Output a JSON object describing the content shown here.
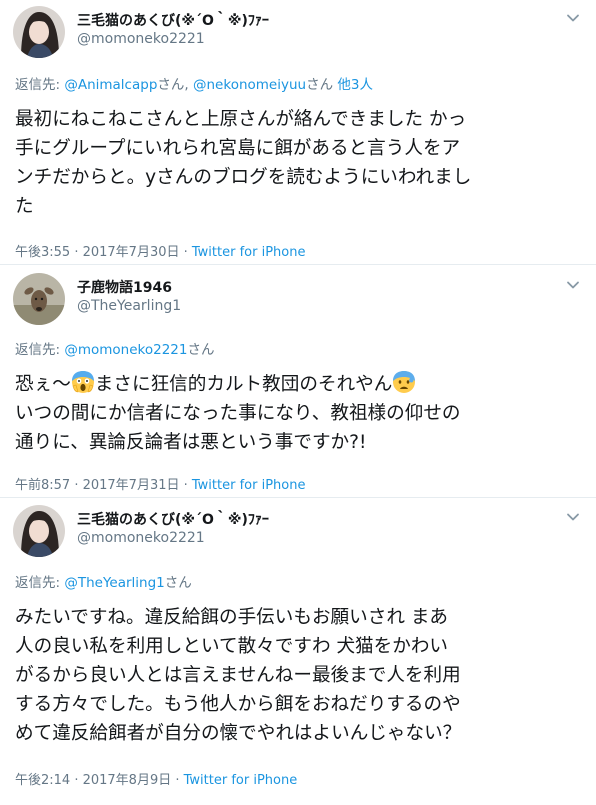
{
  "tweets": [
    {
      "display_name": "三毛猫のあくび(※´O｀※)ﾌｧｰ",
      "handle": "@momoneko2221",
      "reply_prefix": "返信先: ",
      "reply_link1": "@Animalcapp",
      "reply_san1": "さん, ",
      "reply_link2": "@nekonomeiyuu",
      "reply_san2": "さん ",
      "reply_more": "他3人",
      "lines": [
        "最初にねこねこさんと上原さんが絡んできました かっ",
        "手にグループにいれられ宮島に餌があると言う人をア",
        "ンチだからと。yさんのブログを読むようにいわれまし",
        "た"
      ],
      "time": "午後3:55 · 2017年7月30日 · ",
      "source": "Twitter for iPhone"
    },
    {
      "display_name": "子鹿物語1946",
      "handle": "@TheYearling1",
      "reply_prefix": "返信先: ",
      "reply_link1": "@momoneko2221",
      "reply_san1": "さん",
      "line1_a": "恐ぇ〜",
      "line1_b": "まさに狂信的カルト教団のそれやん",
      "lines": [
        "いつの間にか信者になった事になり、教祖様の仰せの",
        "通りに、異論反論者は悪という事ですか?!"
      ],
      "time": "午前8:57 · 2017年7月31日 · ",
      "source": "Twitter for iPhone"
    },
    {
      "display_name": "三毛猫のあくび(※´O｀※)ﾌｧｰ",
      "handle": "@momoneko2221",
      "reply_prefix": "返信先: ",
      "reply_link1": "@TheYearling1",
      "reply_san1": "さん",
      "lines": [
        "みたいですね。違反給餌の手伝いもお願いされ まあ",
        "人の良い私を利用しといて散々ですわ 犬猫をかわい",
        "がるから良い人とは言えませんねー最後まで人を利用",
        "する方々でした。もう他人から餌をおねだりするのや",
        "めて違反給餌者が自分の懐でやれはよいんじゃない？"
      ],
      "time": "午後2:14 · 2017年8月9日 · ",
      "source": "Twitter for iPhone"
    }
  ]
}
